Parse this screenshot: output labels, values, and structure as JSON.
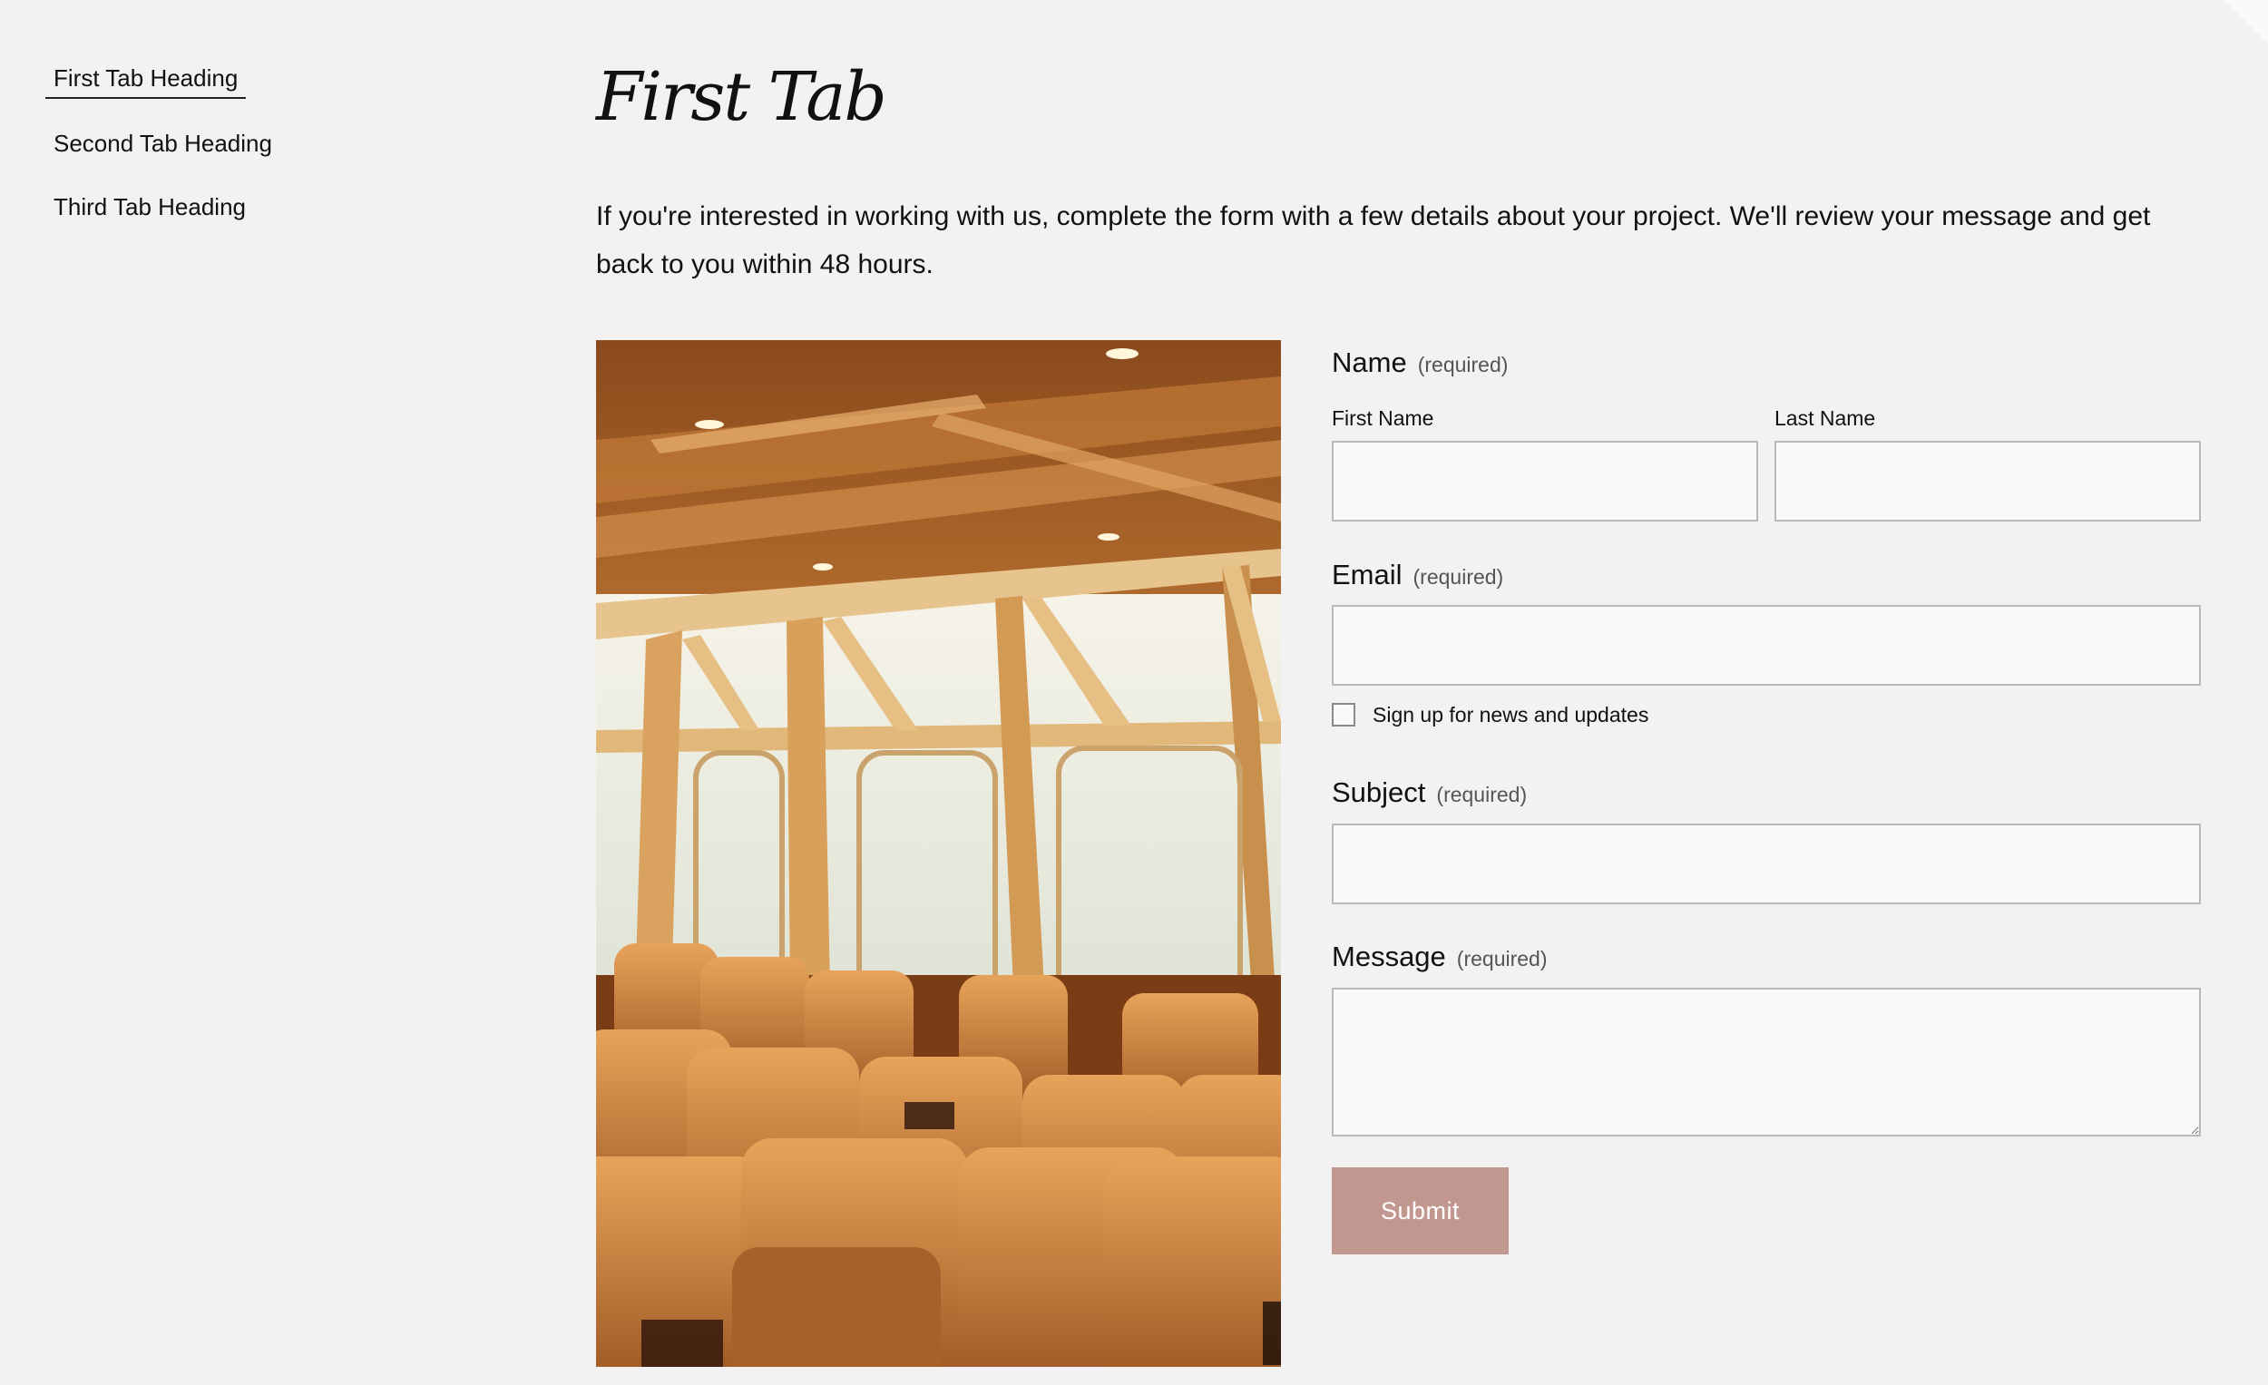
{
  "tabs": {
    "items": [
      {
        "label": "First Tab Heading"
      },
      {
        "label": "Second Tab Heading"
      },
      {
        "label": "Third Tab Heading"
      }
    ]
  },
  "main": {
    "title": "First Tab",
    "intro": "If you're interested in working with us, complete the form with a few details about your project. We'll review your message and get back to you within 48 hours."
  },
  "form": {
    "name": {
      "label": "Name",
      "required": "(required)",
      "first_label": "First Name",
      "last_label": "Last Name",
      "first_value": "",
      "last_value": ""
    },
    "email": {
      "label": "Email",
      "required": "(required)",
      "value": ""
    },
    "newsletter": {
      "label": "Sign up for news and updates",
      "checked": false
    },
    "subject": {
      "label": "Subject",
      "required": "(required)",
      "value": ""
    },
    "message": {
      "label": "Message",
      "required": "(required)",
      "value": ""
    },
    "submit_label": "Submit"
  },
  "colors": {
    "background": "#f2f2f2",
    "input_background": "#f9f9f9",
    "input_border": "#b9b9b9",
    "submit_background": "#c29790",
    "submit_text": "#ffffff"
  }
}
